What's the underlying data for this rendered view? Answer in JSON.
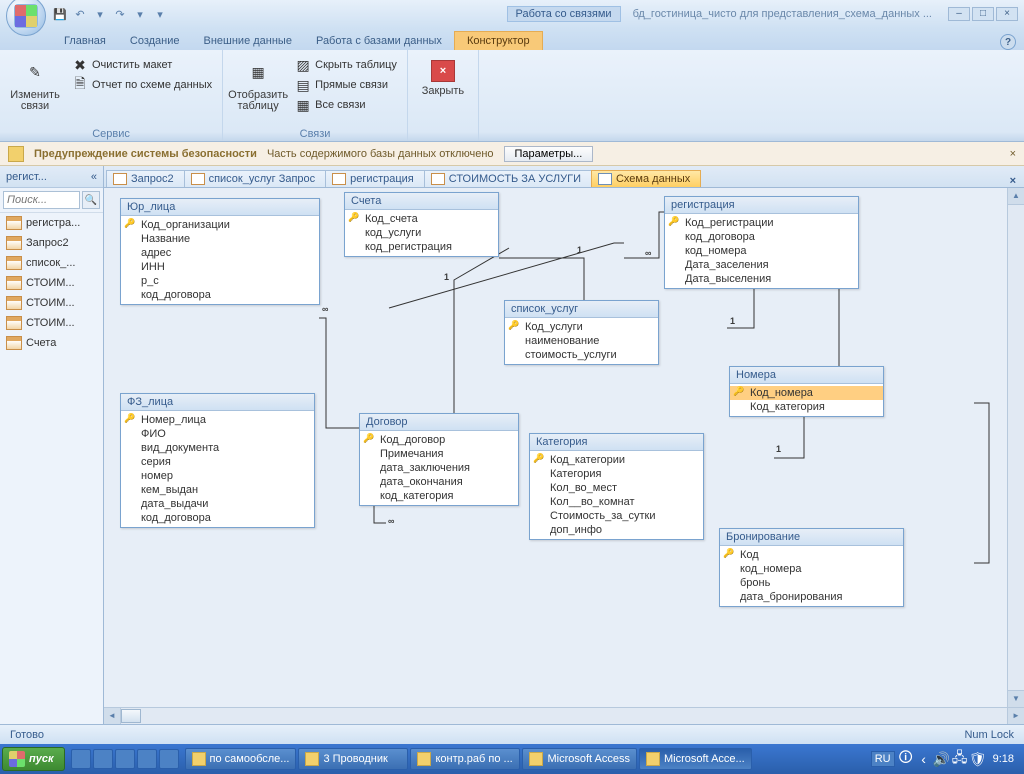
{
  "title": {
    "context_tab": "Работа со связями",
    "filename": "бд_гостиница_чисто для представления_схема_данных ..."
  },
  "qat": {
    "undo": "↶",
    "redo": "↷",
    "save": "💾",
    "drop": "▾"
  },
  "ribbon_tabs": {
    "home": "Главная",
    "create": "Создание",
    "external": "Внешние данные",
    "dbtools": "Работа с базами данных",
    "designer": "Конструктор"
  },
  "ribbon": {
    "g1": {
      "edit_rel": "Изменить связи",
      "clear_layout": "Очистить макет",
      "rel_report": "Отчет по схеме данных",
      "title": "Сервис"
    },
    "g2": {
      "show_table": "Отобразить таблицу",
      "hide_table": "Скрыть таблицу",
      "direct_rel": "Прямые связи",
      "all_rel": "Все связи",
      "title": "Связи"
    },
    "g3": {
      "close": "Закрыть"
    }
  },
  "security": {
    "title": "Предупреждение системы безопасности",
    "msg": "Часть содержимого базы данных отключено",
    "btn": "Параметры..."
  },
  "nav": {
    "header": "регист...",
    "search_placeholder": "Поиск...",
    "items": [
      "регистра...",
      "Запрос2",
      "список_...",
      "СТОИМ...",
      "СТОИМ...",
      "СТОИМ...",
      "Счета"
    ]
  },
  "doc_tabs": {
    "t1": "Запрос2",
    "t2": "список_услуг Запрос",
    "t3": "регистрация",
    "t4": "СТОИМОСТЬ ЗА УСЛУГИ",
    "t5": "Схема данных"
  },
  "tables": {
    "yur": {
      "title": "Юр_лица",
      "fields": [
        "Код_организации",
        "Название",
        "адрес",
        "ИНН",
        "р_с",
        "код_договора"
      ]
    },
    "scheta": {
      "title": "Счета",
      "fields": [
        "Код_счета",
        "код_услуги",
        "код_регистрация"
      ]
    },
    "reg": {
      "title": "регистрация",
      "fields": [
        "Код_регистрации",
        "код_договора",
        "код_номера",
        "Дата_заселения",
        "Дата_выселения"
      ]
    },
    "uslug": {
      "title": "список_услуг",
      "fields": [
        "Код_услуги",
        "наименование",
        "стоимость_услуги"
      ]
    },
    "nomera": {
      "title": "Номера",
      "fields": [
        "Код_номера",
        "Код_категория"
      ]
    },
    "fiz": {
      "title": "ФЗ_лица",
      "fields": [
        "Номер_лица",
        "ФИО",
        "вид_документа",
        "серия",
        "номер",
        "кем_выдан",
        "дата_выдачи",
        "код_договора"
      ]
    },
    "dogovor": {
      "title": "Договор",
      "fields": [
        "Код_договор",
        "Примечания",
        "дата_заключения",
        "дата_окончания",
        "код_категория"
      ]
    },
    "kateg": {
      "title": "Категория",
      "fields": [
        "Код_категории",
        "Категория",
        "Кол_во_мест",
        "Кол__во_комнат",
        "Стоимость_за_сутки",
        "доп_инфо"
      ]
    },
    "bron": {
      "title": "Бронирование",
      "fields": [
        "Код",
        "код_номера",
        "бронь",
        "дата_бронирования"
      ]
    }
  },
  "status": {
    "left": "Готово",
    "right": "Num Lock"
  },
  "taskbar": {
    "start": "пуск",
    "tasks": [
      "по самообсле...",
      "3 Проводник",
      "контр.раб по ...",
      "Microsoft Access",
      "Microsoft Acce..."
    ],
    "lang": "RU",
    "time": "9:18"
  }
}
